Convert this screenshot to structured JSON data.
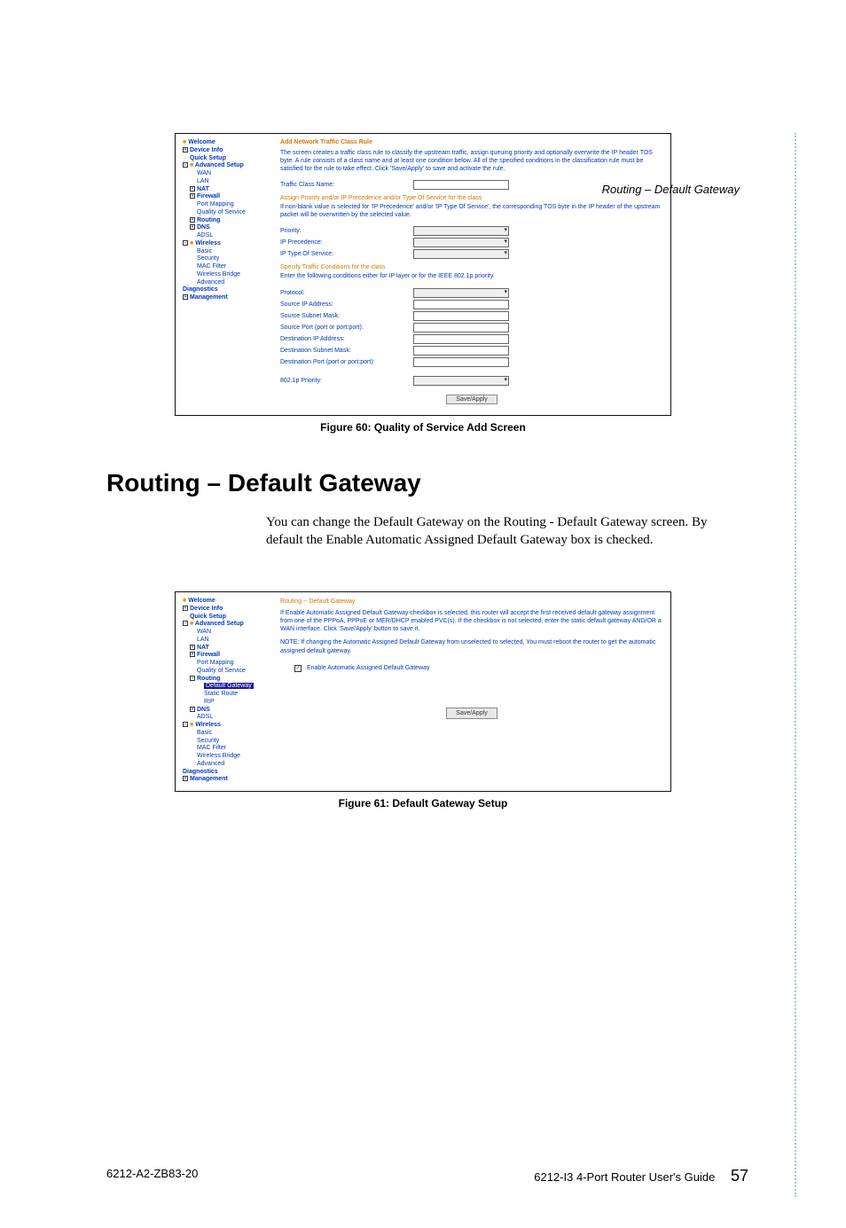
{
  "header": {
    "breadcrumb": "Routing – Default Gateway"
  },
  "fig1": {
    "caption": "Figure 60: Quality of Service Add Screen",
    "tree": {
      "welcome": "Welcome",
      "device_info": "Device Info",
      "quick_setup": "Quick Setup",
      "advanced_setup": "Advanced Setup",
      "wan": "WAN",
      "lan": "LAN",
      "nat": "NAT",
      "firewall": "Firewall",
      "port_mapping": "Port Mapping",
      "qos": "Quality of Service",
      "routing": "Routing",
      "dns": "DNS",
      "adsl": "ADSL",
      "wireless": "Wireless",
      "basic": "Basic",
      "security": "Security",
      "mac_filter": "MAC Filter",
      "wireless_bridge": "Wireless Bridge",
      "advanced": "Advanced",
      "diagnostics": "Diagnostics",
      "management": "Management"
    },
    "panel": {
      "title": "Add Network Traffic Class Rule",
      "desc": "The screen creates a traffic class rule to classify the upstream traffic, assign queuing priority and optionally overwrite the IP header TOS byte. A rule consists of a class name and at least one condition below. All of the specified conditions in the classification rule must be satisfied for the rule to take effect. Click 'Save/Apply' to save and activate the rule.",
      "traffic_class_name": "Traffic Class Name:",
      "sub1_head": "Assign Priority and/or IP Precedence and/or Type Of Service for the class",
      "sub1_desc": "If non-blank value is selected for 'IP Precedence' and/or 'IP Type Of Service', the corresponding TOS byte in the IP header of the upstream packet will be overwritten by the selected value.",
      "priority": "Priority:",
      "ip_precedence": "IP Precedence:",
      "ip_tos": "IP Type Of Service:",
      "sub2_head": "Specify Traffic Conditions for the class",
      "sub2_desc": "Enter the following conditions either for IP layer or for the IEEE 802.1p priority.",
      "protocol": "Protocol:",
      "src_ip": "Source IP Address:",
      "src_mask": "Source Subnet Mask:",
      "src_port": "Source Port (port or port:port):",
      "dst_ip": "Destination IP Address:",
      "dst_mask": "Destination Subnet Mask:",
      "dst_port": "Destination Port (port or port:port):",
      "p8021p": "802.1p Priority:",
      "save": "Save/Apply"
    }
  },
  "section": {
    "heading": "Routing – Default Gateway",
    "body": "You can change the Default Gateway on the Routing - Default Gateway screen. By default the Enable Automatic Assigned Default Gateway box is checked."
  },
  "fig2": {
    "caption": "Figure 61: Default Gateway Setup",
    "tree": {
      "welcome": "Welcome",
      "device_info": "Device Info",
      "quick_setup": "Quick Setup",
      "advanced_setup": "Advanced Setup",
      "wan": "WAN",
      "lan": "LAN",
      "nat": "NAT",
      "firewall": "Firewall",
      "port_mapping": "Port Mapping",
      "qos": "Quality of Service",
      "routing": "Routing",
      "default_gateway": "Default Gateway",
      "static_route": "Static Route",
      "rip": "RIP",
      "dns": "DNS",
      "adsl": "ADSL",
      "wireless": "Wireless",
      "basic": "Basic",
      "security": "Security",
      "mac_filter": "MAC Filter",
      "wireless_bridge": "Wireless Bridge",
      "advanced": "Advanced",
      "diagnostics": "Diagnostics",
      "management": "Management"
    },
    "panel": {
      "title": "Routing -- Default Gateway",
      "desc": "If Enable Automatic Assigned Default Gateway checkbox is selected, this router will accept the first received default gateway assignment from one of the PPPoA, PPPoE or MER/DHCP enabled PVC(s). If the checkbox is not selected, enter the static default gateway AND/OR a WAN interface. Click 'Save/Apply' button to save it.",
      "note": "NOTE: If changing the Automatic Assigned Default Gateway from unselected to selected, You must reboot the router to get the automatic assigned default gateway.",
      "cb_label": "Enable Automatic Assigned Default Gateway",
      "save": "Save/Apply"
    }
  },
  "footer": {
    "left": "6212-A2-ZB83-20",
    "right": "6212-I3 4-Port Router User's Guide",
    "page": "57"
  }
}
